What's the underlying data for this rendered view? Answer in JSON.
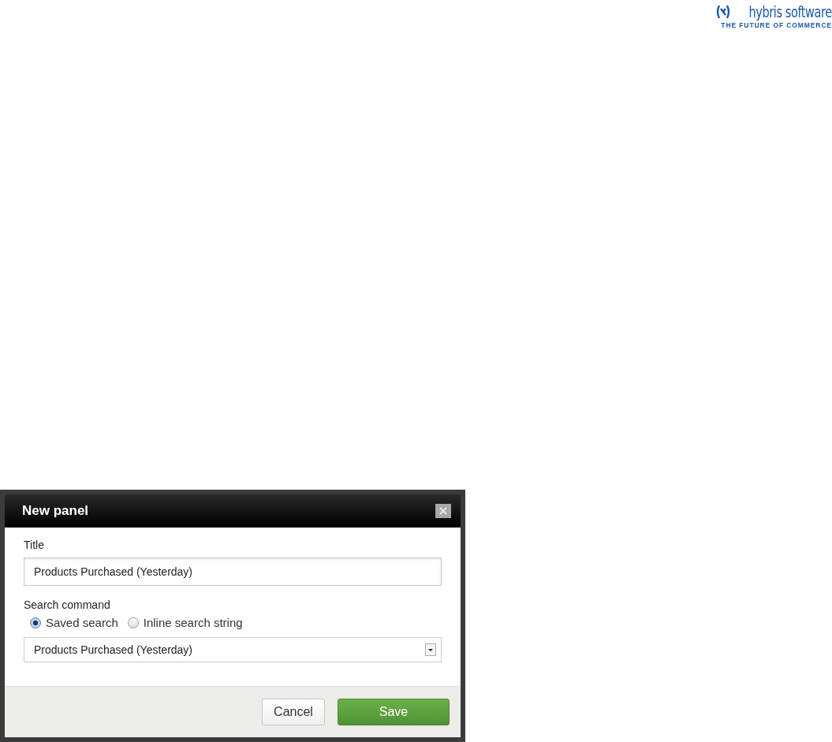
{
  "logo": {
    "name": "hybris software",
    "tagline": "THE FUTURE OF COMMERCE"
  },
  "dialog": {
    "title": "New panel",
    "fields": [
      {
        "kind": "text",
        "label": "Title",
        "value": "Products Purchased (Yesterday)"
      },
      {
        "kind": "radio-select",
        "label": "Search command",
        "options": [
          {
            "label": "Saved search",
            "selected": true
          },
          {
            "label": "Inline search string",
            "selected": false
          }
        ],
        "value": "Products Purchased (Yesterday)"
      }
    ],
    "buttons": [
      {
        "kind": "secondary",
        "label": "Cancel"
      },
      {
        "kind": "primary",
        "label": "Save"
      }
    ]
  }
}
